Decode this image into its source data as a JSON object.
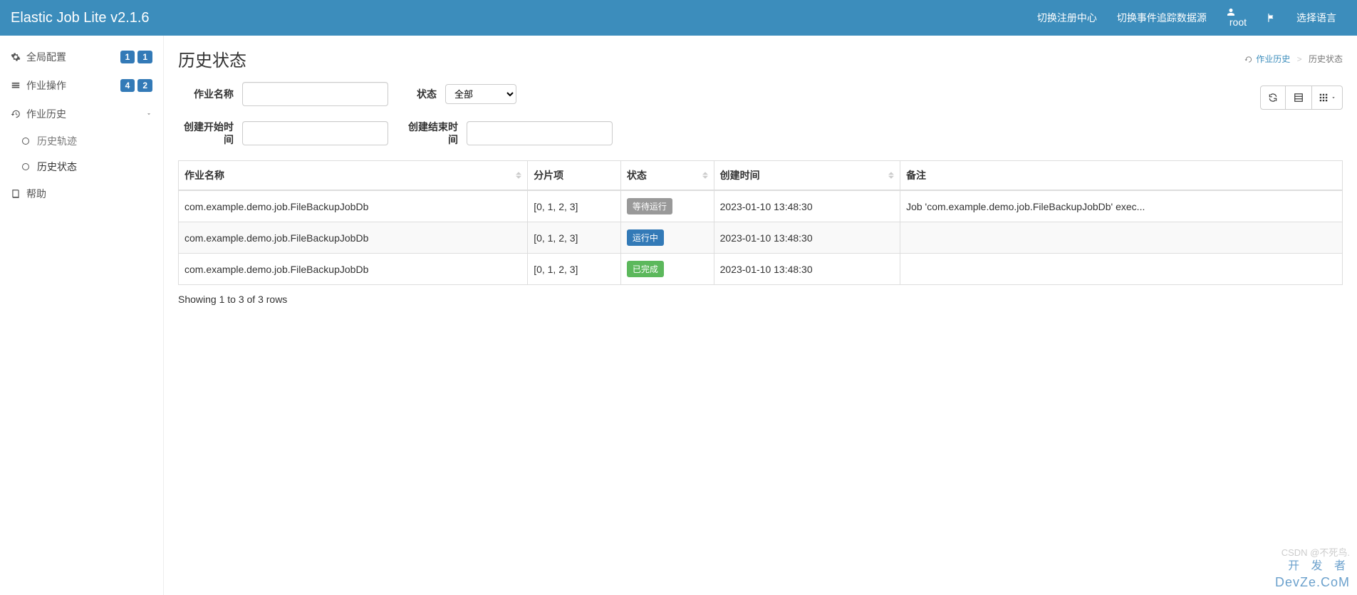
{
  "navbar": {
    "brand": "Elastic Job Lite v2.1.6",
    "switch_registry": "切换注册中心",
    "switch_trace": "切换事件追踪数据源",
    "user": "root",
    "language": "选择语言"
  },
  "sidebar": {
    "global_config": {
      "label": "全局配置",
      "badges": [
        "1",
        "1"
      ]
    },
    "job_ops": {
      "label": "作业操作",
      "badges": [
        "4",
        "2"
      ]
    },
    "job_history": {
      "label": "作业历史"
    },
    "history_trace": {
      "label": "历史轨迹"
    },
    "history_status": {
      "label": "历史状态"
    },
    "help": {
      "label": "帮助"
    }
  },
  "breadcrumb": {
    "parent": "作业历史",
    "current": "历史状态"
  },
  "page": {
    "title": "历史状态"
  },
  "filters": {
    "job_name_label": "作业名称",
    "job_name_value": "",
    "status_label": "状态",
    "status_value": "全部",
    "create_start_label": "创建开始时间",
    "create_start_value": "",
    "create_end_label": "创建结束时间",
    "create_end_value": ""
  },
  "table": {
    "headers": {
      "job_name": "作业名称",
      "sharding": "分片项",
      "status": "状态",
      "create_time": "创建时间",
      "remark": "备注"
    },
    "rows": [
      {
        "job_name": "com.example.demo.job.FileBackupJobDb",
        "sharding": "[0, 1, 2, 3]",
        "status_text": "等待运行",
        "status_class": "st-waiting",
        "create_time": "2023-01-10 13:48:30",
        "remark": "Job 'com.example.demo.job.FileBackupJobDb' exec..."
      },
      {
        "job_name": "com.example.demo.job.FileBackupJobDb",
        "sharding": "[0, 1, 2, 3]",
        "status_text": "运行中",
        "status_class": "st-running",
        "create_time": "2023-01-10 13:48:30",
        "remark": ""
      },
      {
        "job_name": "com.example.demo.job.FileBackupJobDb",
        "sharding": "[0, 1, 2, 3]",
        "status_text": "已完成",
        "status_class": "st-done",
        "create_time": "2023-01-10 13:48:30",
        "remark": ""
      }
    ]
  },
  "pagination": {
    "info": "Showing 1 to 3 of 3 rows"
  },
  "watermark": {
    "line0": "CSDN @不死鸟.",
    "line1": "开 发 者",
    "line2": "DevZe.CoM"
  }
}
